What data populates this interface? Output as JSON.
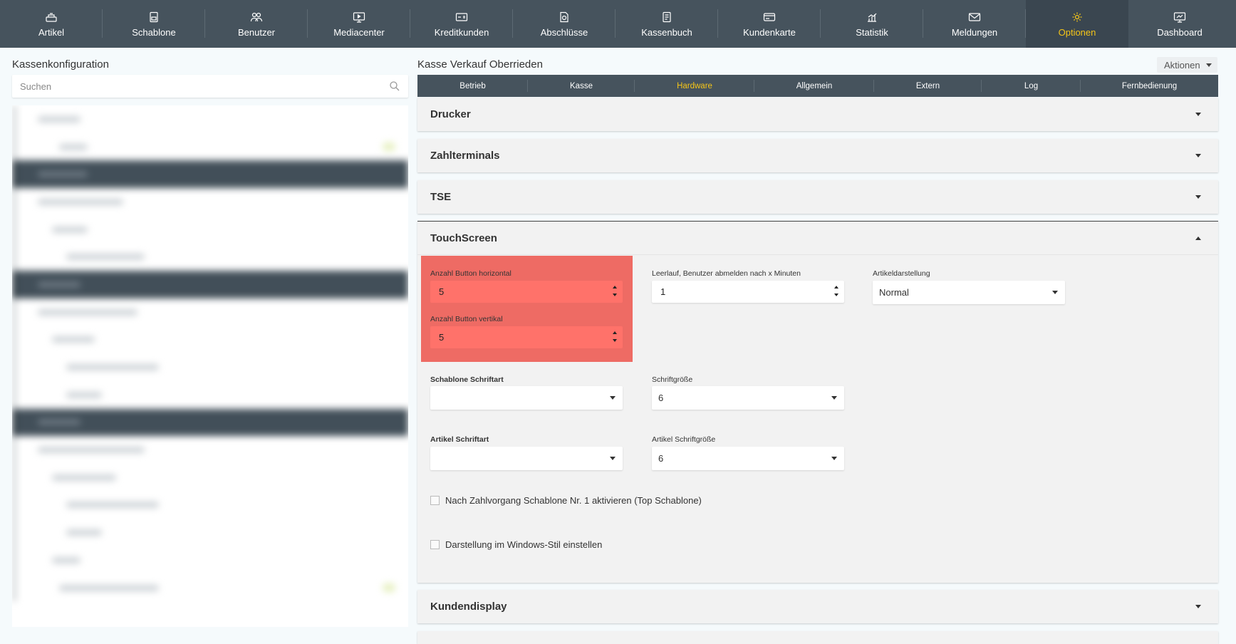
{
  "nav": [
    {
      "label": "Artikel",
      "icon": "cashier-icon"
    },
    {
      "label": "Schablone",
      "icon": "save-icon"
    },
    {
      "label": "Benutzer",
      "icon": "users-icon"
    },
    {
      "label": "Mediacenter",
      "icon": "monitor-icon"
    },
    {
      "label": "Kreditkunden",
      "icon": "card-icon"
    },
    {
      "label": "Abschlüsse",
      "icon": "document-icon"
    },
    {
      "label": "Kassenbuch",
      "icon": "ledger-icon"
    },
    {
      "label": "Kundenkarte",
      "icon": "customer-card-icon"
    },
    {
      "label": "Statistik",
      "icon": "chart-icon"
    },
    {
      "label": "Meldungen",
      "icon": "mail-icon"
    },
    {
      "label": "Optionen",
      "icon": "gear-icon",
      "active": true
    },
    {
      "label": "Dashboard",
      "icon": "dashboard-icon"
    }
  ],
  "left": {
    "title": "Kassenkonfiguration",
    "search_placeholder": "Suchen"
  },
  "right": {
    "title": "Kasse Verkauf Oberrieden",
    "actions_label": "Aktionen",
    "tabs": [
      "Betrieb",
      "Kasse",
      "Hardware",
      "Allgemein",
      "Extern",
      "Log",
      "Fernbedienung"
    ],
    "active_tab": "Hardware",
    "panels": {
      "drucker": "Drucker",
      "zahlterminals": "Zahlterminals",
      "tse": "TSE",
      "touchscreen": "TouchScreen",
      "kundendisplay": "Kundendisplay"
    },
    "touchscreen": {
      "buttons_h_label": "Anzahl Button horizontal",
      "buttons_h_value": "5",
      "buttons_v_label": "Anzahl Button vertikal",
      "buttons_v_value": "5",
      "idle_label": "Leerlauf, Benutzer abmelden nach x Minuten",
      "idle_value": "1",
      "article_display_label": "Artikeldarstellung",
      "article_display_value": "Normal",
      "template_font_label": "Schablone Schriftart",
      "template_font_value": "",
      "font_size_label": "Schriftgröße",
      "font_size_value": "6",
      "article_font_label": "Artikel Schriftart",
      "article_font_value": "",
      "article_font_size_label": "Artikel Schriftgröße",
      "article_font_size_value": "6",
      "check_template_label": "Nach Zahlvorgang Schablone Nr. 1 aktivieren (Top Schablone)",
      "check_windows_label": "Darstellung im Windows-Stil einstellen"
    }
  },
  "colors": {
    "nav_bg": "#46535d",
    "accent": "#f5c518",
    "highlight": "#ee6b64"
  }
}
